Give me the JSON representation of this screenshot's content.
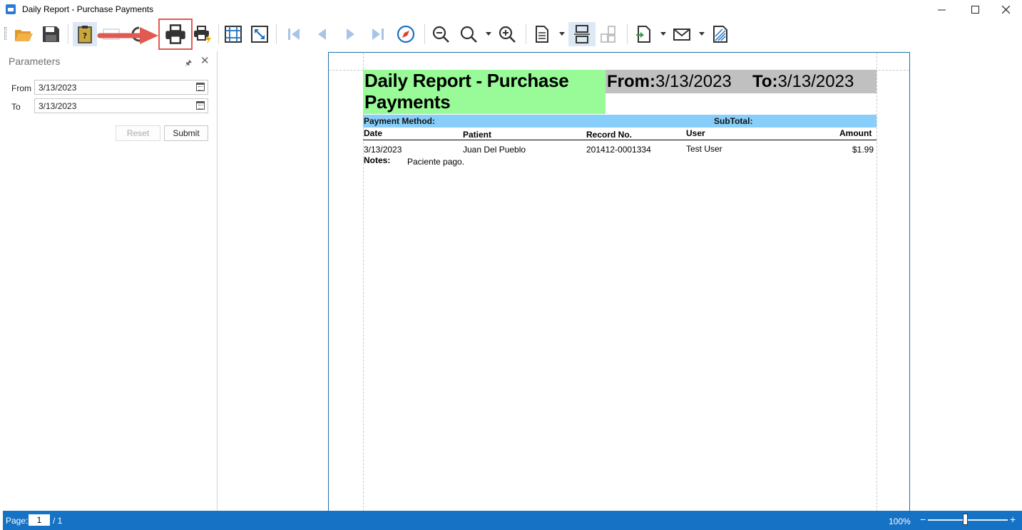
{
  "window": {
    "title": "Daily Report - Purchase Payments"
  },
  "toolbar": {
    "icons": [
      "folder-open-icon",
      "save-icon",
      "document-map-icon",
      "print-icon",
      "quick-print-icon",
      "page-setup-icon",
      "fit-page-icon",
      "first-page-icon",
      "previous-page-icon",
      "next-page-icon",
      "last-page-icon",
      "navigate-icon",
      "zoom-out-icon",
      "zoom-icon",
      "zoom-in-icon",
      "page-layout-icon",
      "multi-page-icon",
      "continuous-icon",
      "export-icon",
      "email-icon",
      "watermark-icon"
    ],
    "annotation_color": "#e05a4f"
  },
  "parameters": {
    "title": "Parameters",
    "from_label": "From",
    "from_value": "3/13/2023",
    "to_label": "To",
    "to_value": "3/13/2023",
    "reset_label": "Reset",
    "submit_label": "Submit"
  },
  "report": {
    "title": "Daily Report - Purchase Payments",
    "from_label": "From:",
    "from_value": "3/13/2023",
    "to_label": "To:",
    "to_value": "3/13/2023",
    "group_label": "Payment Method:",
    "subtotal_label": "SubTotal:",
    "columns": [
      "Date",
      "Patient",
      "Record No.",
      "User",
      "Amount"
    ],
    "rows": [
      {
        "date": "3/13/2023",
        "patient": "Juan Del Pueblo",
        "record": "201412-0001334",
        "user": "Test User",
        "amount": "$1.99",
        "notes_label": "Notes:",
        "notes": "Paciente pago."
      }
    ],
    "colors": {
      "title_bg": "#98fb98",
      "dates_bg": "#c0c0c0",
      "group_bg": "#87cefa"
    }
  },
  "statusbar": {
    "page_label": "Page:",
    "page_current": "1",
    "page_total": "/ 1",
    "zoom": "100%",
    "zoom_minus": "−",
    "zoom_plus": "+",
    "bg_color": "#1672c4"
  }
}
